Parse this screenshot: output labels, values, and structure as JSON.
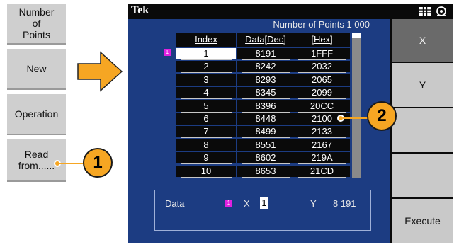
{
  "left_menu": {
    "number_of_points": "Number\nof\nPoints",
    "new": "New",
    "operation": "Operation",
    "read_from": "Read\nfrom......"
  },
  "screen": {
    "brand": "Tek",
    "number_of_points": "Number of Points 1 000",
    "table": {
      "headers": [
        "Index",
        "Data[Dec]",
        "[Hex]"
      ],
      "rows": [
        [
          "1",
          "8191",
          "1FFF"
        ],
        [
          "2",
          "8242",
          "2032"
        ],
        [
          "3",
          "8293",
          "2065"
        ],
        [
          "4",
          "8345",
          "2099"
        ],
        [
          "5",
          "8396",
          "20CC"
        ],
        [
          "6",
          "8448",
          "2100"
        ],
        [
          "7",
          "8499",
          "2133"
        ],
        [
          "8",
          "8551",
          "2167"
        ],
        [
          "9",
          "8602",
          "219A"
        ],
        [
          "10",
          "8653",
          "21CD"
        ]
      ],
      "selected_index": "1"
    },
    "marker": "1",
    "data_panel": {
      "label": "Data",
      "x_label": "X",
      "x_value": "1",
      "y_label": "Y",
      "y_value": "8 191"
    }
  },
  "right_menu": {
    "x": "X",
    "y": "Y",
    "execute": "Execute"
  },
  "callouts": {
    "one": "1",
    "two": "2"
  },
  "colors": {
    "screen_bg": "#1c3c82",
    "callout": "#f6a623",
    "marker": "#e020e0"
  }
}
